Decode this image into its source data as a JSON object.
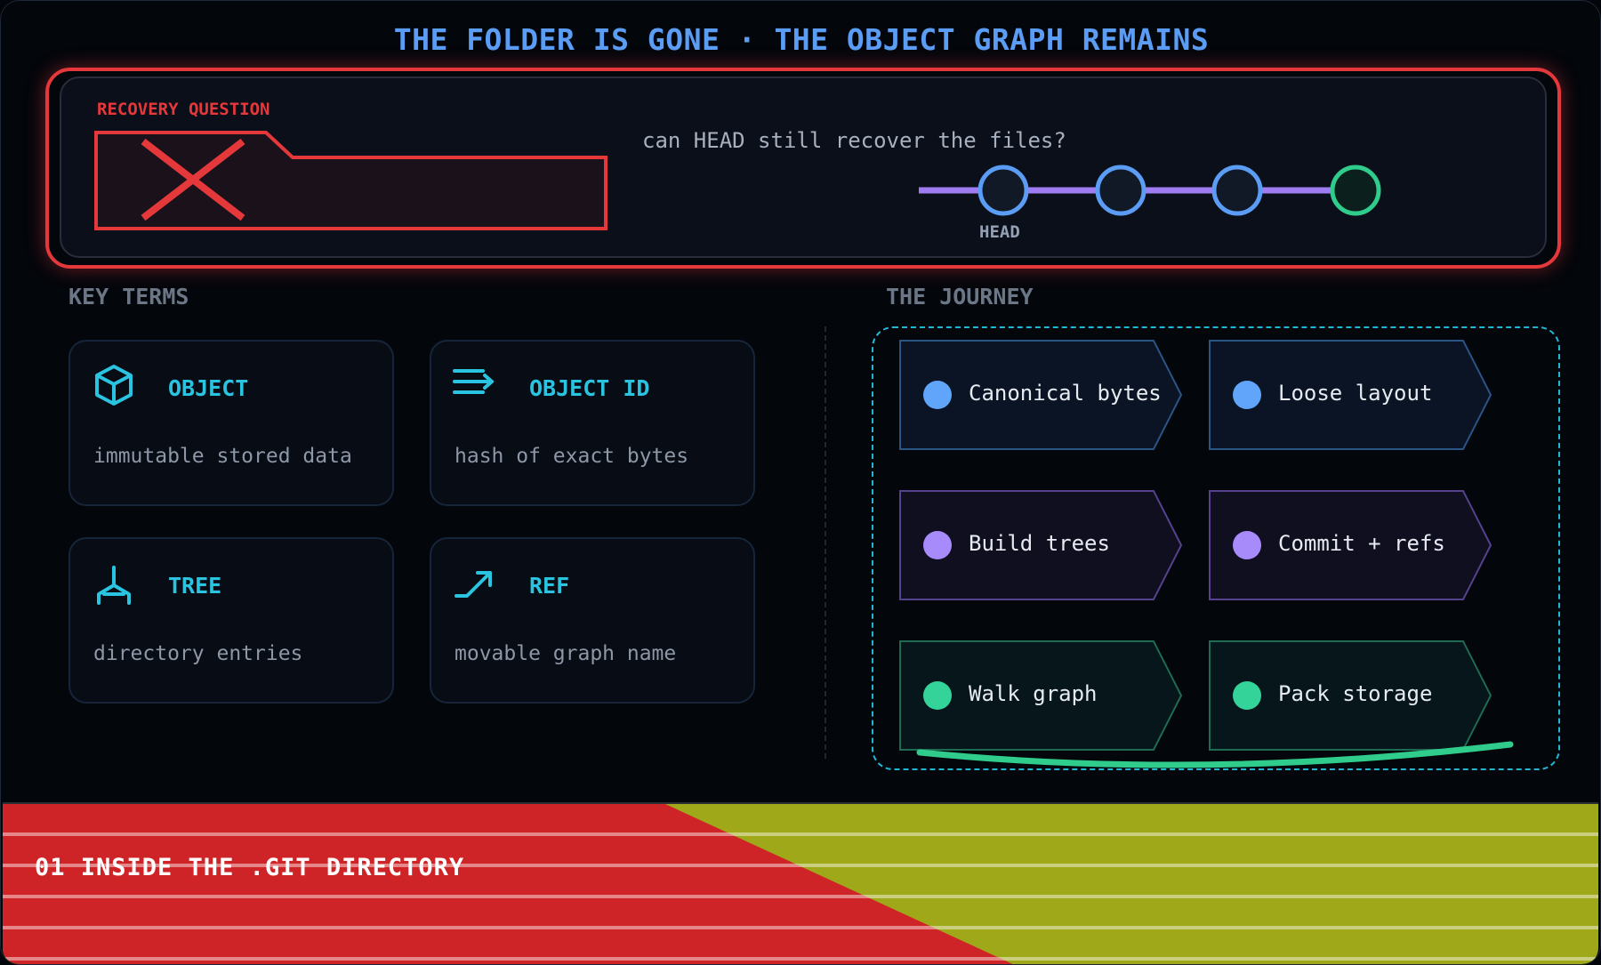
{
  "title": "THE FOLDER IS GONE · THE OBJECT GRAPH REMAINS",
  "recovery": {
    "label": "RECOVERY QUESTION",
    "question": "can HEAD still recover the files?",
    "head_label": "HEAD",
    "colors": {
      "alert": "#e5383b",
      "branch": "#a07cf3",
      "commit": "#5b9df5",
      "tip": "#2fcc8c"
    }
  },
  "key_terms": {
    "heading": "KEY TERMS",
    "items": [
      {
        "icon": "cube-icon",
        "title": "OBJECT",
        "desc": "immutable stored data"
      },
      {
        "icon": "lines-arrow-icon",
        "title": "OBJECT ID",
        "desc": "hash of exact bytes"
      },
      {
        "icon": "tree-branch-icon",
        "title": "TREE",
        "desc": "directory entries"
      },
      {
        "icon": "up-right-arrow-icon",
        "title": "REF",
        "desc": "movable graph name"
      }
    ]
  },
  "journey": {
    "heading": "THE JOURNEY",
    "steps": [
      {
        "label": "Canonical bytes",
        "color": "#60a5fa"
      },
      {
        "label": "Loose layout",
        "color": "#60a5fa"
      },
      {
        "label": "Build trees",
        "color": "#a78bfa"
      },
      {
        "label": "Commit + refs",
        "color": "#a78bfa"
      },
      {
        "label": "Walk graph",
        "color": "#34d399"
      },
      {
        "label": "Pack storage",
        "color": "#34d399"
      }
    ]
  },
  "footer": {
    "label": "01 INSIDE THE .GIT DIRECTORY",
    "colors": {
      "left": "#cf2427",
      "right": "#9ea818"
    }
  }
}
